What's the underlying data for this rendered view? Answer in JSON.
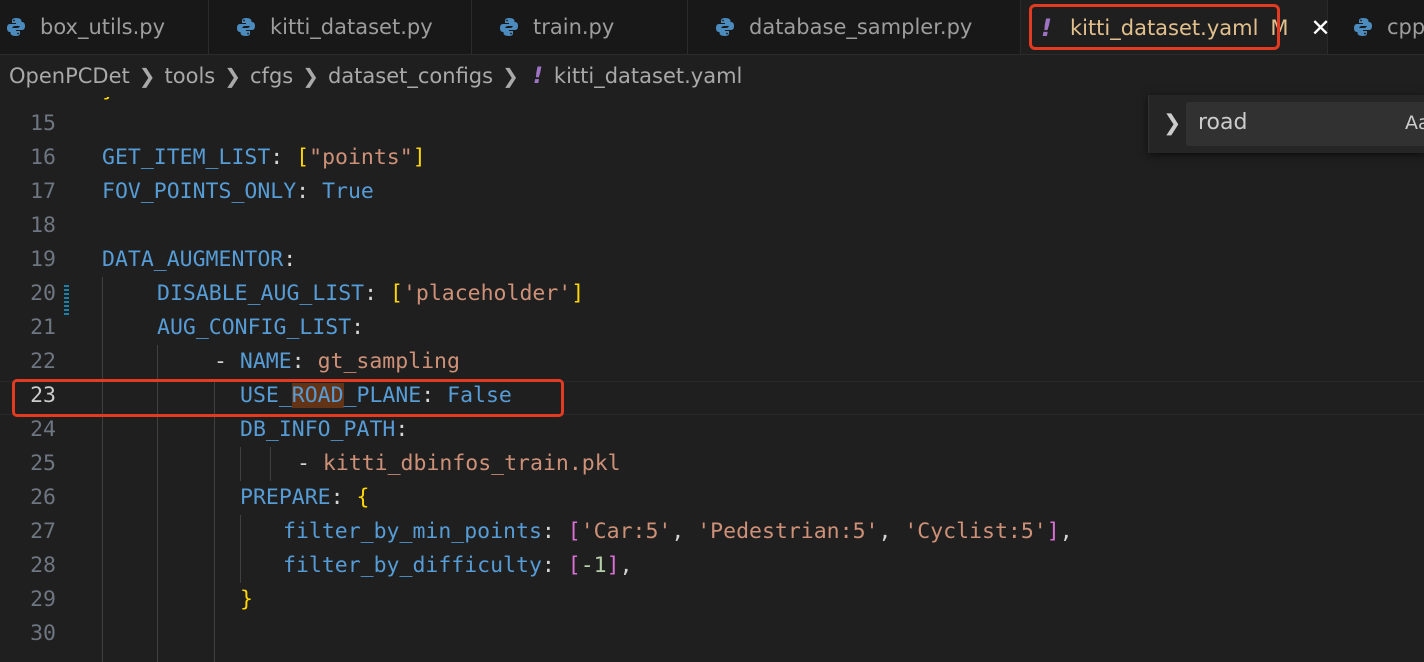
{
  "tabs": [
    {
      "label": "box_utils.py"
    },
    {
      "label": "kitti_dataset.py"
    },
    {
      "label": "train.py"
    },
    {
      "label": "database_sampler.py"
    },
    {
      "label": "kitti_dataset.yaml",
      "modified": "M"
    },
    {
      "label": "cpp"
    }
  ],
  "breadcrumb": [
    "OpenPCDet",
    "tools",
    "cfgs",
    "dataset_configs",
    "kitti_dataset.yaml"
  ],
  "find": {
    "value": "road",
    "case_label": "Aa"
  },
  "lines": [
    {
      "n": "15"
    },
    {
      "n": "16"
    },
    {
      "n": "17"
    },
    {
      "n": "18"
    },
    {
      "n": "19"
    },
    {
      "n": "20"
    },
    {
      "n": "21"
    },
    {
      "n": "22"
    },
    {
      "n": "23"
    },
    {
      "n": "24"
    },
    {
      "n": "25"
    },
    {
      "n": "26"
    },
    {
      "n": "27"
    },
    {
      "n": "28"
    },
    {
      "n": "29"
    },
    {
      "n": "30"
    }
  ],
  "code": {
    "l16_key": "GET_ITEM_LIST",
    "l16_val": "\"points\"",
    "l17_key": "FOV_POINTS_ONLY",
    "l17_val": "True",
    "l19_key": "DATA_AUGMENTOR",
    "l20_key": "DISABLE_AUG_LIST",
    "l20_val": "'placeholder'",
    "l21_key": "AUG_CONFIG_LIST",
    "l22_key": "NAME",
    "l22_val": "gt_sampling",
    "l23_pre": "USE_",
    "l23_match": "ROAD",
    "l23_post": "_PLANE",
    "l23_val": "False",
    "l24_key": "DB_INFO_PATH",
    "l25_val": "kitti_dbinfos_train.pkl",
    "l26_key": "PREPARE",
    "l27_key": "filter_by_min_points",
    "l27_v1": "'Car:5'",
    "l27_v2": "'Pedestrian:5'",
    "l27_v3": "'Cyclist:5'",
    "l28_key": "filter_by_difficulty",
    "l28_val": "-1"
  },
  "colors": {
    "highlight": "#e23b22",
    "tab_active_text": "#e2c08d",
    "keyword": "#569cd6",
    "string": "#ce9178"
  }
}
